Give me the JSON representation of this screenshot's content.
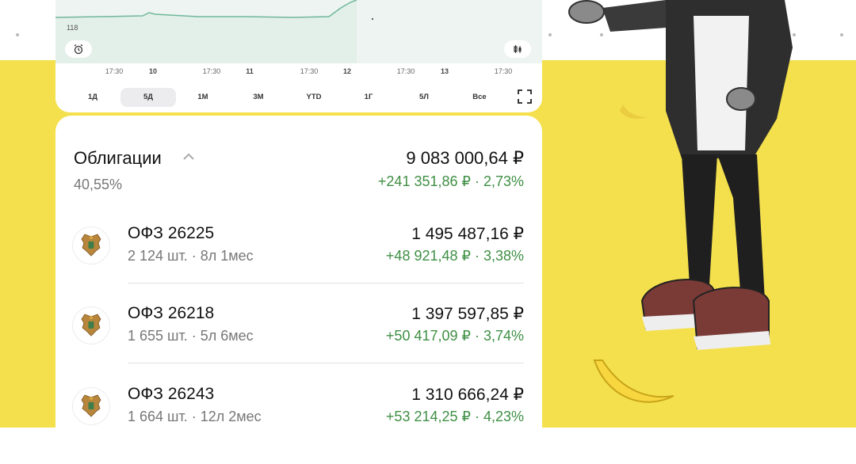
{
  "chart": {
    "y_label": "118",
    "x_labels": [
      {
        "text": "17:30",
        "bold": false
      },
      {
        "text": "10",
        "bold": true
      },
      {
        "text": "17:30",
        "bold": false
      },
      {
        "text": "11",
        "bold": true
      },
      {
        "text": "17:30",
        "bold": false
      },
      {
        "text": "12",
        "bold": true
      },
      {
        "text": "17:30",
        "bold": false
      },
      {
        "text": "13",
        "bold": true
      },
      {
        "text": "17:30",
        "bold": false
      }
    ],
    "periods": [
      {
        "label": "1Д",
        "active": false
      },
      {
        "label": "5Д",
        "active": true
      },
      {
        "label": "1М",
        "active": false
      },
      {
        "label": "3М",
        "active": false
      },
      {
        "label": "YTD",
        "active": false
      },
      {
        "label": "1Г",
        "active": false
      },
      {
        "label": "5Л",
        "active": false
      },
      {
        "label": "Все",
        "active": false
      }
    ],
    "line_color": "#6fb89a"
  },
  "section": {
    "title": "Облигации",
    "share": "40,55%",
    "value": "9 083 000,64 ₽",
    "change": "+241 351,86 ₽ · 2,73%"
  },
  "bonds": [
    {
      "name": "ОФЗ 26225",
      "details": "2 124 шт. · 8л 1мес",
      "value": "1 495 487,16 ₽",
      "change": "+48 921,48 ₽ · 3,38%"
    },
    {
      "name": "ОФЗ 26218",
      "details": "1 655 шт. · 5л 6мес",
      "value": "1 397 597,85 ₽",
      "change": "+50 417,09 ₽ · 3,74%"
    },
    {
      "name": "ОФЗ 26243",
      "details": "1 664 шт. · 12л 2мес",
      "value": "1 310 666,24 ₽",
      "change": "+53 214,25 ₽ · 4,23%"
    }
  ],
  "colors": {
    "positive": "#3f8f44",
    "background_yellow": "#f4e04d"
  }
}
